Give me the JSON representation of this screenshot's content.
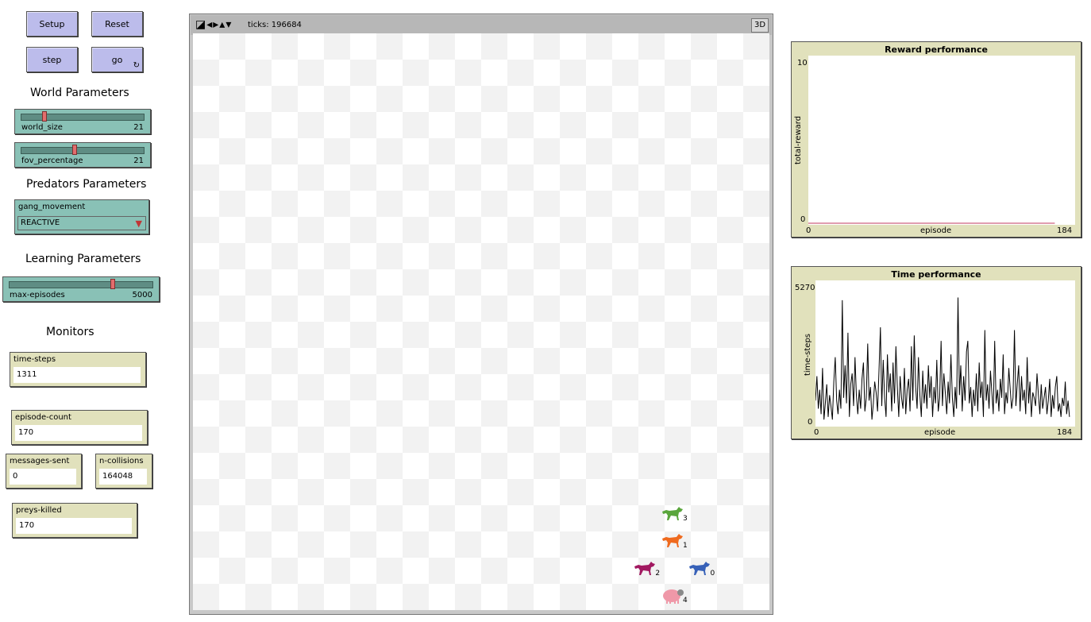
{
  "buttons": {
    "setup": "Setup",
    "reset": "Reset",
    "step": "step",
    "go": "go",
    "forever_icon": "↻"
  },
  "sections": {
    "world": "World Parameters",
    "predators": "Predators Parameters",
    "learning": "Learning Parameters",
    "monitors": "Monitors"
  },
  "sliders": {
    "world_size": {
      "label": "world_size",
      "value": "21",
      "fraction": 0.18
    },
    "fov_percentage": {
      "label": "fov_percentage",
      "value": "21",
      "fraction": 0.43
    },
    "max_episodes": {
      "label": "max-episodes",
      "value": "5000",
      "fraction": 0.73
    }
  },
  "chooser": {
    "label": "gang_movement",
    "value": "REACTIVE",
    "icon": "triangle-down-icon"
  },
  "monitors": {
    "time_steps": {
      "label": "time-steps",
      "value": "1311"
    },
    "episode_count": {
      "label": "episode-count",
      "value": "170"
    },
    "messages_sent": {
      "label": "messages-sent",
      "value": "0"
    },
    "n_collisions": {
      "label": "n-collisions",
      "value": "164048"
    },
    "preys_killed": {
      "label": "preys-killed",
      "value": "170"
    }
  },
  "view": {
    "ticks": "ticks: 196684",
    "btn3d": "3D",
    "tools_icons": "◪◂▸▴▾",
    "agents": [
      {
        "id": "3",
        "kind": "wolf",
        "color": "#5aa63c",
        "col": 17,
        "row": 17
      },
      {
        "id": "1",
        "kind": "wolf",
        "color": "#ef6a1e",
        "col": 17,
        "row": 18
      },
      {
        "id": "2",
        "kind": "wolf",
        "color": "#a11860",
        "col": 16,
        "row": 19
      },
      {
        "id": "0",
        "kind": "wolf",
        "color": "#3761b8",
        "col": 18,
        "row": 19
      },
      {
        "id": "4",
        "kind": "sheep",
        "color": "#ef98a8",
        "col": 17,
        "row": 20
      }
    ]
  },
  "chart_data": [
    {
      "type": "line",
      "title": "Reward performance",
      "xlabel": "episode",
      "ylabel": "total-reward",
      "xlim": [
        0,
        184
      ],
      "ylim": [
        0,
        10
      ],
      "x_tick_labels": [
        "0",
        "184"
      ],
      "y_tick_labels": [
        "0",
        "10"
      ],
      "series": [
        {
          "color": "#c0395f",
          "x": [
            0,
            170
          ],
          "y": [
            0,
            0
          ]
        }
      ]
    },
    {
      "type": "line",
      "title": "Time performance",
      "xlabel": "episode",
      "ylabel": "time-steps",
      "xlim": [
        0,
        184
      ],
      "ylim": [
        0,
        5270
      ],
      "x_tick_labels": [
        "0",
        "184"
      ],
      "y_tick_labels": [
        "0",
        "5270"
      ],
      "series": [
        {
          "color": "#000000",
          "y": [
            900,
            1800,
            600,
            1300,
            400,
            2100,
            200,
            800,
            1500,
            300,
            1100,
            700,
            200,
            1600,
            2500,
            900,
            400,
            1300,
            600,
            4600,
            1000,
            2200,
            800,
            3400,
            300,
            1500,
            1900,
            700,
            2500,
            1100,
            400,
            1300,
            600,
            1700,
            2300,
            500,
            1000,
            3000,
            900,
            1400,
            200,
            800,
            1600,
            1200,
            500,
            2000,
            3600,
            700,
            2400,
            1000,
            300,
            2600,
            1200,
            1900,
            500,
            2300,
            800,
            2900,
            1400,
            300,
            1800,
            1000,
            600,
            2100,
            400,
            1300,
            1700,
            500,
            2900,
            900,
            3300,
            1400,
            600,
            2500,
            1100,
            300,
            2000,
            800,
            1500,
            600,
            2200,
            1000,
            1800,
            300,
            1400,
            800,
            2400,
            500,
            1000,
            3100,
            700,
            1900,
            1200,
            400,
            1600,
            800,
            2600,
            1000,
            300,
            1400,
            600,
            4700,
            1100,
            2200,
            500,
            1800,
            900,
            2700,
            3100,
            800,
            1400,
            300,
            1300,
            700,
            1900,
            500,
            2300,
            1000,
            1600,
            300,
            3500,
            900,
            1500,
            600,
            2000,
            1200,
            400,
            3100,
            800,
            1300,
            500,
            1700,
            1000,
            2600,
            400,
            1200,
            800,
            2100,
            1300,
            600,
            1000,
            3500,
            700,
            1500,
            2200,
            500,
            1800,
            900,
            1300,
            400,
            2500,
            800,
            1600,
            300,
            1200,
            1000,
            700,
            1900,
            1100,
            400,
            1500,
            600,
            1000,
            1400,
            400,
            900,
            1700,
            300,
            1100,
            600,
            1400,
            1800,
            500,
            800,
            300,
            1000,
            700,
            1600,
            400,
            900,
            300
          ]
        }
      ]
    }
  ]
}
